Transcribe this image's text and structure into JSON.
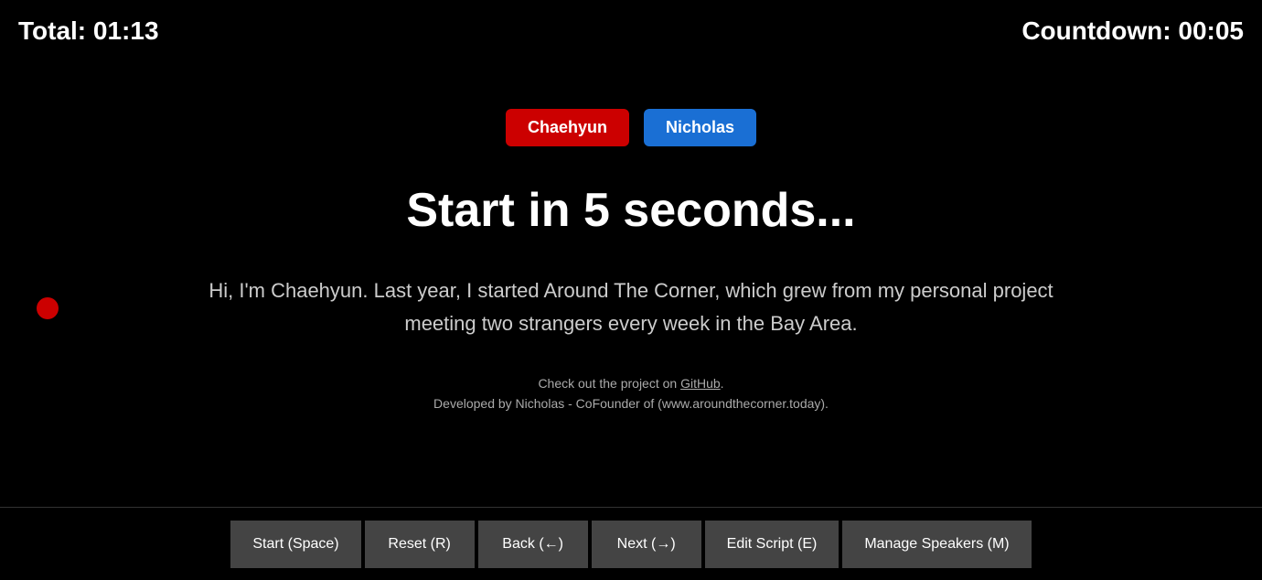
{
  "timers": {
    "total_label": "Total: 01:13",
    "countdown_label": "Countdown: 00:05"
  },
  "speakers": [
    {
      "name": "Chaehyun",
      "color": "red"
    },
    {
      "name": "Nicholas",
      "color": "blue"
    }
  ],
  "countdown": {
    "text": "Start in 5 seconds..."
  },
  "script": {
    "text": "Hi, I'm Chaehyun. Last year, I started Around The Corner, which grew from my personal project meeting two strangers every week in the Bay Area."
  },
  "footer": {
    "line1_prefix": "Check out the project on ",
    "github_link_text": "GitHub",
    "line1_suffix": ".",
    "line2": "Developed by Nicholas - CoFounder of (www.aroundthecorner.today)."
  },
  "toolbar": {
    "buttons": [
      {
        "label": "Start (Space)",
        "name": "start-button"
      },
      {
        "label": "Reset (R)",
        "name": "reset-button"
      },
      {
        "label": "Back (←)",
        "name": "back-button"
      },
      {
        "label": "Next (→)",
        "name": "next-button"
      },
      {
        "label": "Edit Script (E)",
        "name": "edit-script-button"
      },
      {
        "label": "Manage Speakers (M)",
        "name": "manage-speakers-button"
      }
    ]
  }
}
